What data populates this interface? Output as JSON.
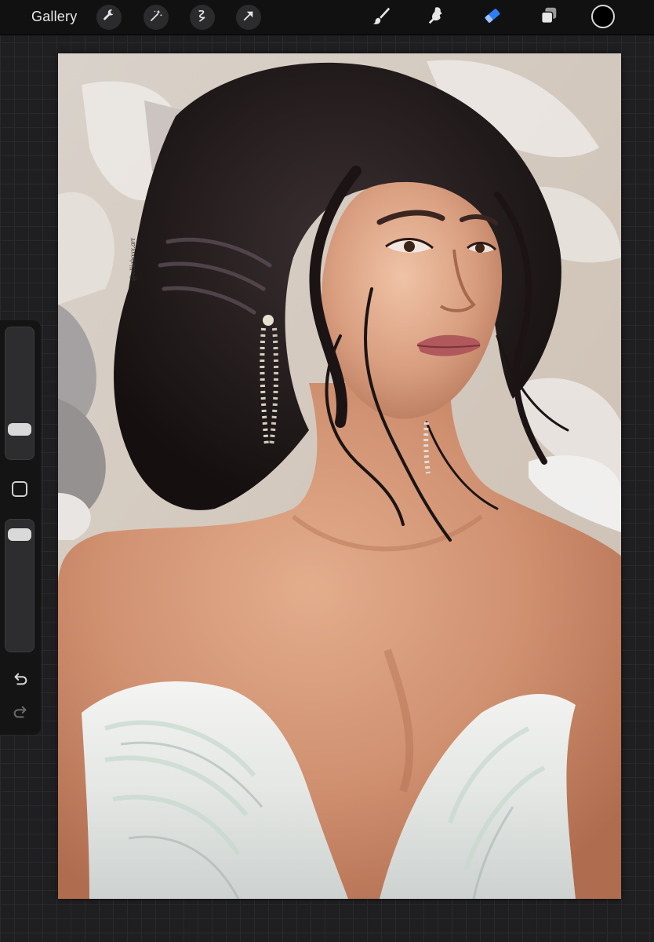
{
  "toolbar": {
    "gallery_label": "Gallery",
    "actions": [
      {
        "name": "wrench-icon",
        "label": "Actions"
      },
      {
        "name": "magic-wand-icon",
        "label": "Adjustments"
      },
      {
        "name": "selection-icon",
        "label": "Selection"
      },
      {
        "name": "transform-arrow-icon",
        "label": "Transform"
      }
    ],
    "tools": [
      {
        "name": "brush-icon",
        "active": false
      },
      {
        "name": "smudge-icon",
        "active": false
      },
      {
        "name": "eraser-icon",
        "active": true
      },
      {
        "name": "layers-icon",
        "active": false
      }
    ],
    "current_color": "#000000",
    "active_color": "#2f7df6"
  },
  "sidebar": {
    "brush_size_level": 0.82,
    "brush_opacity_level": 0.05,
    "undo_icon": "undo-icon",
    "redo_icon": "redo-icon"
  },
  "artwork": {
    "signature": "@ollieboux.art"
  }
}
